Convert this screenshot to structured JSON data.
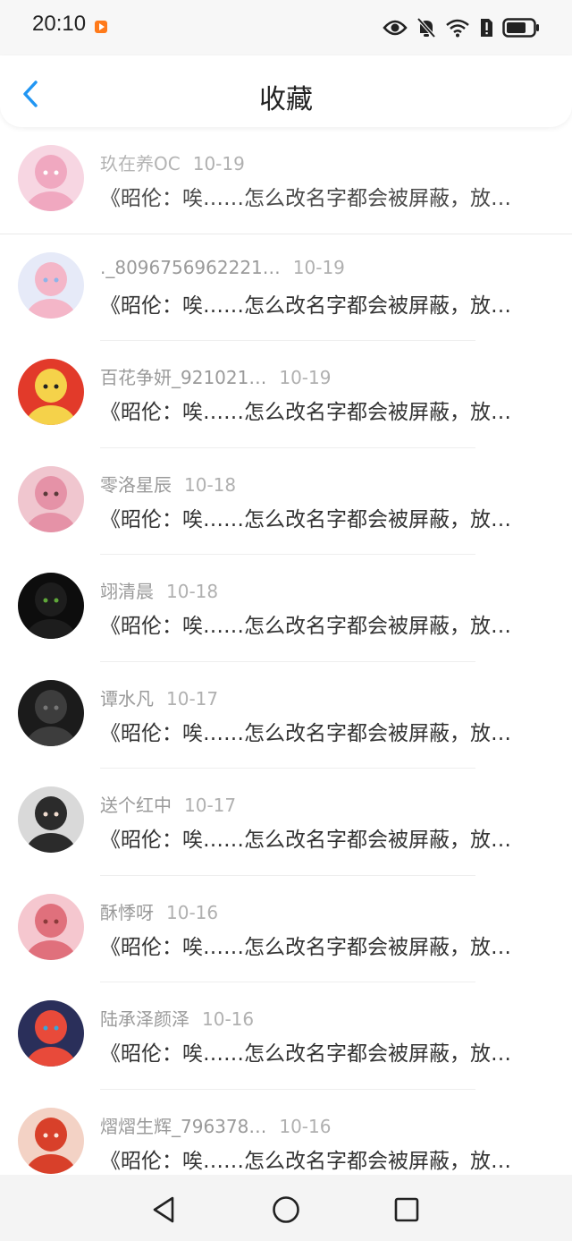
{
  "status": {
    "time": "20:10"
  },
  "header": {
    "title": "收藏"
  },
  "items": [
    {
      "user": "玖在养OC",
      "date": "10-19",
      "text": "《昭伦：唉……怎么改名字都会被屏蔽，放…",
      "avatar": {
        "bg": "#f7d6e2",
        "fg": "#f0a8c0",
        "accent": "#ffffff"
      }
    },
    {
      "user": "._8096756962221…",
      "date": "10-19",
      "text": "《昭伦：唉……怎么改名字都会被屏蔽，放…",
      "avatar": {
        "bg": "#e6eaf8",
        "fg": "#f4b6c8",
        "accent": "#8fb4e8"
      }
    },
    {
      "user": "百花争妍_921021…",
      "date": "10-19",
      "text": "《昭伦：唉……怎么改名字都会被屏蔽，放…",
      "avatar": {
        "bg": "#e23a2a",
        "fg": "#f5d24a",
        "accent": "#222222"
      }
    },
    {
      "user": "零洛星辰",
      "date": "10-18",
      "text": "《昭伦：唉……怎么改名字都会被屏蔽，放…",
      "avatar": {
        "bg": "#f0c6cf",
        "fg": "#e592a7",
        "accent": "#5a3a3a"
      }
    },
    {
      "user": "翊清晨",
      "date": "10-18",
      "text": "《昭伦：唉……怎么改名字都会被屏蔽，放…",
      "avatar": {
        "bg": "#0d0d0d",
        "fg": "#1d1d1d",
        "accent": "#5fa83a"
      }
    },
    {
      "user": "谭水凡",
      "date": "10-17",
      "text": "《昭伦：唉……怎么改名字都会被屏蔽，放…",
      "avatar": {
        "bg": "#1b1b1b",
        "fg": "#3d3d3d",
        "accent": "#777777"
      }
    },
    {
      "user": "送个红中",
      "date": "10-17",
      "text": "《昭伦：唉……怎么改名字都会被屏蔽，放…",
      "avatar": {
        "bg": "#d9d9d9",
        "fg": "#2b2b2b",
        "accent": "#f1ddd0"
      }
    },
    {
      "user": "酥悸呀",
      "date": "10-16",
      "text": "《昭伦：唉……怎么改名字都会被屏蔽，放…",
      "avatar": {
        "bg": "#f5c7cf",
        "fg": "#e0707c",
        "accent": "#8a3a3a"
      }
    },
    {
      "user": "陆承泽颜泽",
      "date": "10-16",
      "text": "《昭伦：唉……怎么改名字都会被屏蔽，放…",
      "avatar": {
        "bg": "#2a2f5a",
        "fg": "#e84a3a",
        "accent": "#3aa6d8"
      }
    },
    {
      "user": "熠熠生辉_796378…",
      "date": "10-16",
      "text": "《昭伦：唉……怎么改名字都会被屏蔽，放…",
      "avatar": {
        "bg": "#f3d2c5",
        "fg": "#d8402a",
        "accent": "#fbe6dc"
      }
    }
  ],
  "colors": {
    "accent": "#2196f3"
  }
}
